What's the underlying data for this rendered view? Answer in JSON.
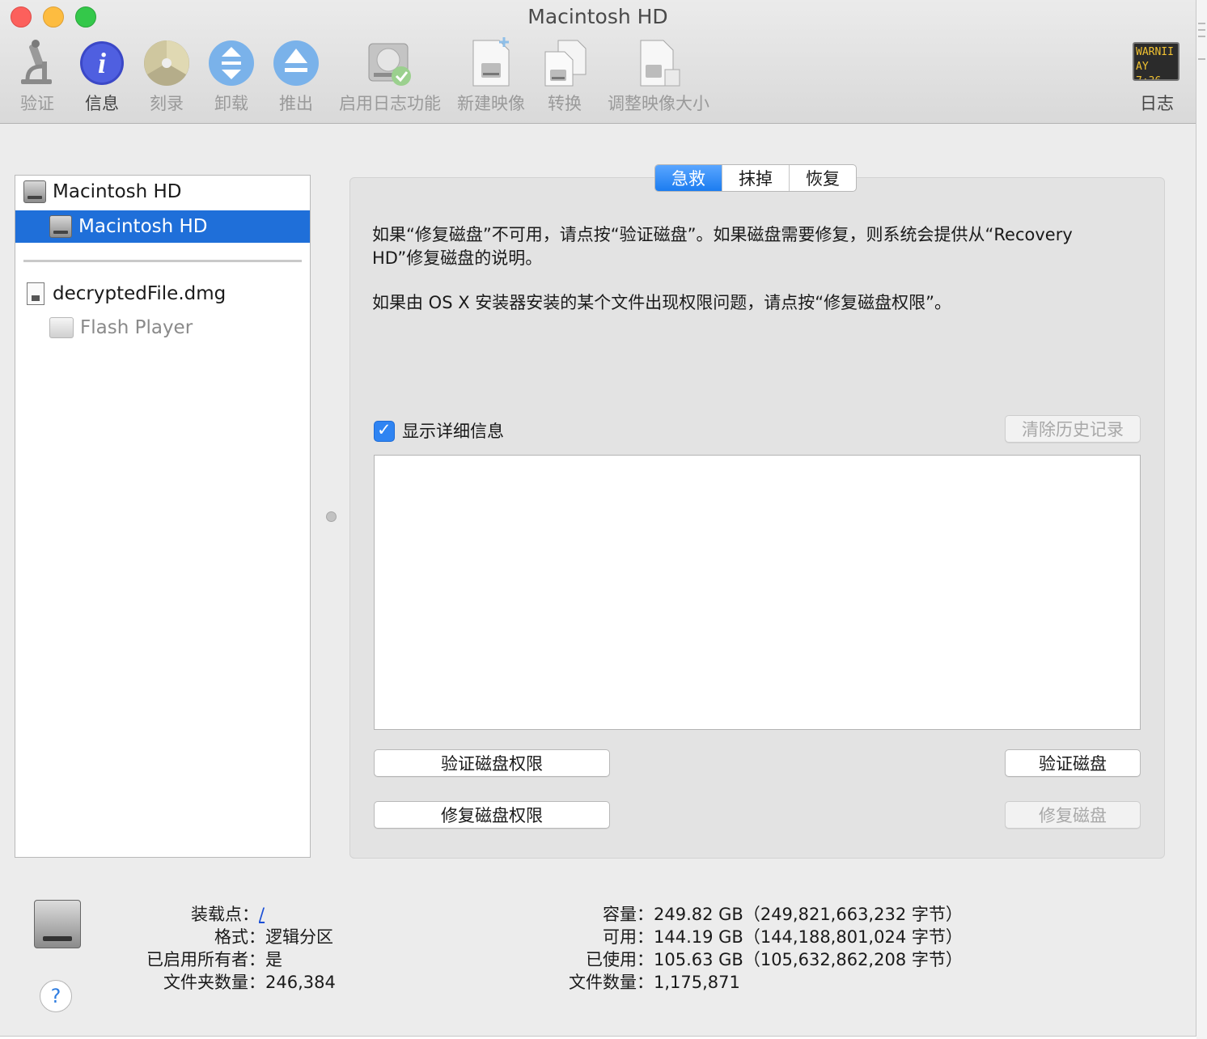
{
  "window": {
    "title": "Macintosh HD"
  },
  "toolbar": {
    "items": [
      {
        "label": "验证",
        "icon": "microscope-icon",
        "enabled": false
      },
      {
        "label": "信息",
        "icon": "info-icon",
        "enabled": true
      },
      {
        "label": "刻录",
        "icon": "burn-icon",
        "enabled": false
      },
      {
        "label": "卸载",
        "icon": "unmount-icon",
        "enabled": false
      },
      {
        "label": "推出",
        "icon": "eject-icon",
        "enabled": false
      },
      {
        "label": "启用日志功能",
        "icon": "journaling-icon",
        "enabled": false
      },
      {
        "label": "新建映像",
        "icon": "new-image-icon",
        "enabled": false
      },
      {
        "label": "转换",
        "icon": "convert-icon",
        "enabled": false
      },
      {
        "label": "调整映像大小",
        "icon": "resize-image-icon",
        "enabled": false
      },
      {
        "label": "日志",
        "icon": "log-console-icon",
        "enabled": true
      }
    ],
    "log_icon_text": {
      "line1": "WARNII",
      "line2": "AY 7:36"
    }
  },
  "sidebar": {
    "items": [
      {
        "label": "Macintosh HD"
      },
      {
        "label": "Macintosh HD"
      },
      {
        "label": "decryptedFile.dmg"
      },
      {
        "label": "Flash Player"
      }
    ]
  },
  "tabs": {
    "items": [
      "急救",
      "抹掉",
      "恢复"
    ],
    "selected": 0
  },
  "first_aid": {
    "para1": "如果“修复磁盘”不可用，请点按“验证磁盘”。如果磁盘需要修复，则系统会提供从“Recovery HD”修复磁盘的说明。",
    "para2": "如果由 OS X 安装器安装的某个文件出现权限问题，请点按“修复磁盘权限”。",
    "show_details": {
      "label": "显示详细信息",
      "checked": true
    },
    "clear_history": "清除历史记录",
    "verify_permissions": "验证磁盘权限",
    "repair_permissions": "修复磁盘权限",
    "verify_disk": "验证磁盘",
    "repair_disk": "修复磁盘"
  },
  "info": {
    "mount_point_label": "装载点：",
    "mount_point_value": "/",
    "format_label": "格式：",
    "format_value": "逻辑分区",
    "owners_label": "已启用所有者：",
    "owners_value": "是",
    "folders_label": "文件夹数量：",
    "folders_value": "246,384",
    "capacity_label": "容量：",
    "capacity_value": "249.82 GB（249,821,663,232 字节）",
    "available_label": "可用：",
    "available_value": "144.19 GB（144,188,801,024 字节）",
    "used_label": "已使用：",
    "used_value": "105.63 GB（105,632,862,208 字节）",
    "files_label": "文件数量：",
    "files_value": "1,175,871"
  },
  "help": {
    "glyph": "?"
  },
  "colors": {
    "accent": "#1f6fd9",
    "tab_selected": "#1b7cf0"
  }
}
